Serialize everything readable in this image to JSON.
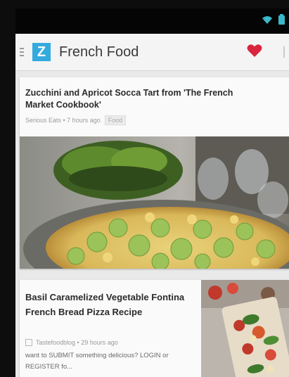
{
  "app": {
    "title": "French Food",
    "logo_letter": "Z",
    "accent_color": "#33aadd",
    "heart_color": "#d9263e"
  },
  "status_bar": {
    "icons": [
      "wifi-icon",
      "battery-icon"
    ]
  },
  "articles": [
    {
      "title_line1": "Zucchini and Apricot Socca Tart from 'The French",
      "title_line2": "Market Cookbook'",
      "meta": "Serious Eats • 7 hours ago",
      "tag": "Food",
      "image_icon": "pizza-tart-photo"
    },
    {
      "title": "Basil Caramelized Vegetable Fontina French Bread Pizza Recipe",
      "meta": "Tastefoodblog • 29 hours ago",
      "snippet": "want to SUBMIT something delicious? LOGIN or REGISTER fo...",
      "image_icon": "bread-pizza-photo"
    }
  ]
}
